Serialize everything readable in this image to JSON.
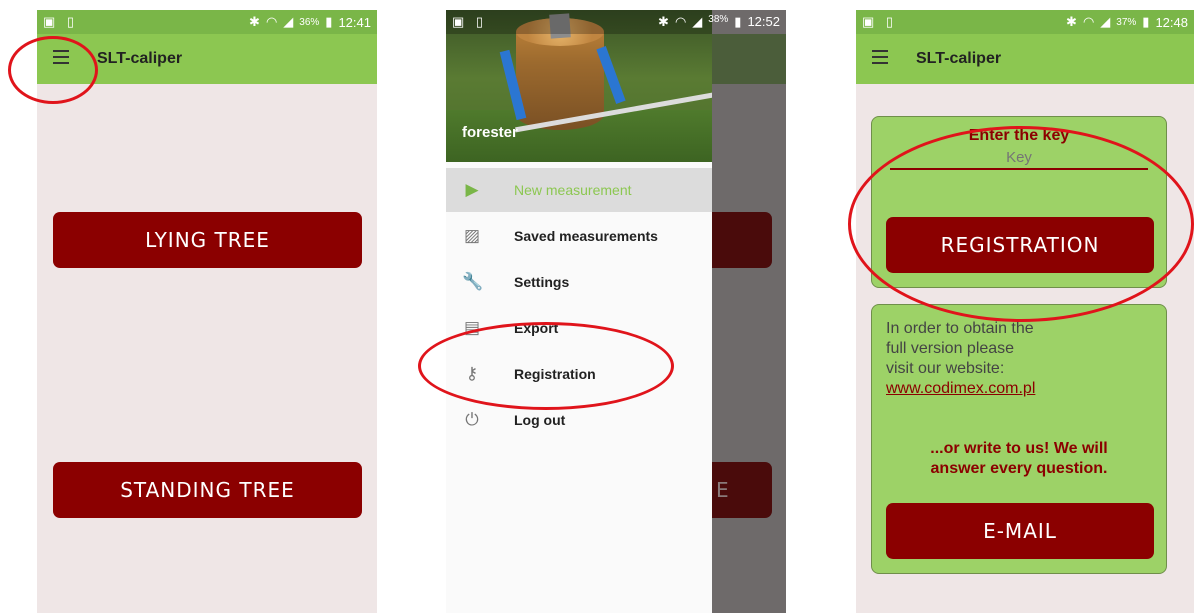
{
  "phone1": {
    "status": {
      "left_icons": "▣ ▯",
      "battery": "36%",
      "time": "12:41"
    },
    "toolbar": {
      "title": "SLT-caliper",
      "menu_icon": "hamburger-icon"
    },
    "buttons": {
      "lying": "LYING TREE",
      "standing": "STANDING TREE"
    }
  },
  "phone2": {
    "status": {
      "left_icons": "▣ ▯",
      "battery": "38%",
      "time": "12:52"
    },
    "header_user": "forester",
    "menu": [
      {
        "label": "New measurement",
        "icon": "play-icon",
        "glyph": "▶"
      },
      {
        "label": "Saved measurements",
        "icon": "image-icon",
        "glyph": "▨"
      },
      {
        "label": "Settings",
        "icon": "wrench-icon",
        "glyph": "🔧"
      },
      {
        "label": "Export",
        "icon": "save-icon",
        "glyph": "▤"
      },
      {
        "label": "Registration",
        "icon": "key-icon",
        "glyph": "⚷"
      },
      {
        "label": "Log out",
        "icon": "power-icon",
        "glyph": "⏻"
      }
    ],
    "background_button_fragment": "E"
  },
  "phone3": {
    "status": {
      "left_icons": "▣ ▯",
      "battery": "37%",
      "time": "12:48"
    },
    "toolbar": {
      "title": "SLT-caliper",
      "menu_icon": "hamburger-icon"
    },
    "registration": {
      "heading": "Enter the key",
      "key_placeholder": "Key",
      "button": "REGISTRATION"
    },
    "info": {
      "line1": "In order to obtain the",
      "line2": "full version please",
      "line3": "visit our website:",
      "link": "www.codimex.com.pl",
      "bold1": "...or write to us! We will",
      "bold2": "answer every question.",
      "button": "E-MAIL"
    }
  },
  "colors": {
    "toolbar": "#8cc751",
    "status": "#7ab648",
    "button": "#8b0000",
    "highlight": "#e0141b"
  }
}
